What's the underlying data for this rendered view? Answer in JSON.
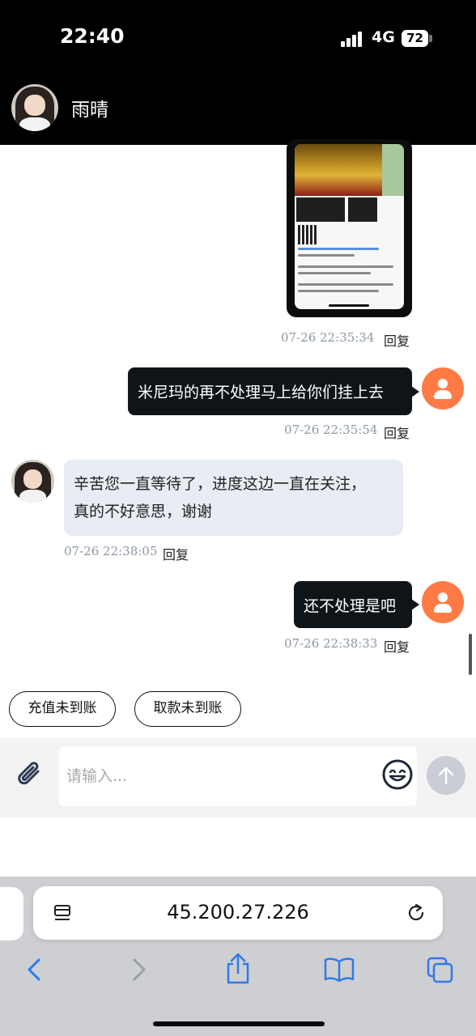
{
  "status_bar": {
    "time": "22:40",
    "network": "4G",
    "battery": "72"
  },
  "header": {
    "contact_name": "雨晴"
  },
  "messages": [
    {
      "side": "out",
      "type": "image",
      "timestamp": "07-26 22:35:34",
      "reply_label": "回复"
    },
    {
      "side": "out",
      "type": "text",
      "text": "米尼玛的再不处理马上给你们挂上去",
      "timestamp": "07-26 22:35:54",
      "reply_label": "回复"
    },
    {
      "side": "in",
      "type": "text",
      "text_line1": "辛苦您一直等待了，进度这边一直在关注，",
      "text_line2": "真的不好意思，谢谢",
      "timestamp": "07-26 22:38:05",
      "reply_label": "回复"
    },
    {
      "side": "out",
      "type": "text",
      "text": "还不处理是吧",
      "timestamp": "07-26 22:38:33",
      "reply_label": "回复"
    }
  ],
  "quick_replies": [
    "充值未到账",
    "取款未到账"
  ],
  "composer": {
    "placeholder": "请输入..."
  },
  "browser": {
    "url": "45.200.27.226",
    "icons": [
      "tabs-list-icon",
      "reload-icon",
      "back-icon",
      "forward-icon",
      "share-icon",
      "bookmarks-icon",
      "tabs-icon"
    ]
  },
  "colors": {
    "header_bg": "#000000",
    "outgoing_bubble": "#0f1419",
    "incoming_bubble": "#e8edf4",
    "user_avatar": "#ff7a45",
    "link_blue": "#2f7ae5"
  }
}
